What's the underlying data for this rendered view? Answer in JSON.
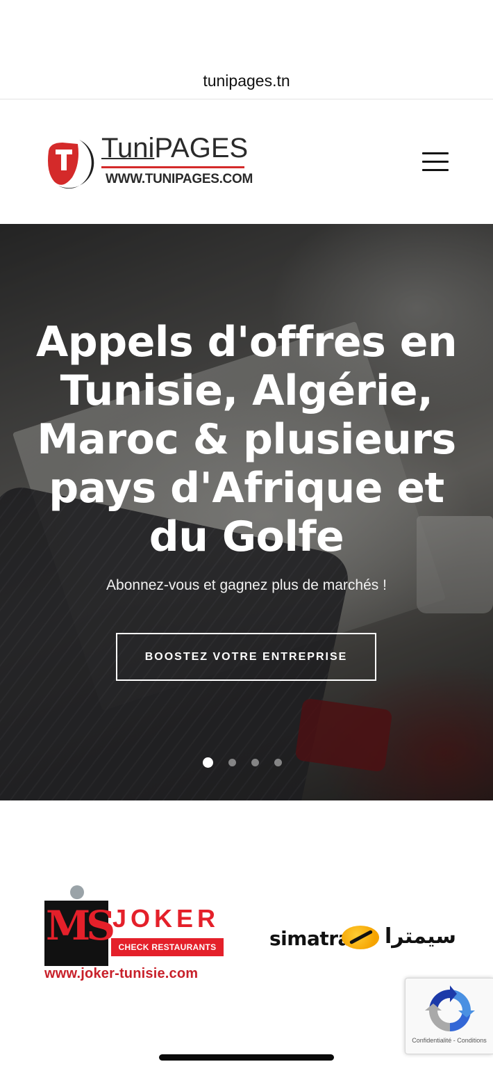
{
  "browser": {
    "url": "tunipages.tn"
  },
  "header": {
    "logo": {
      "brand_tuni": "Tuni",
      "brand_pages": "PAGES",
      "website": "WWW.TUNIPAGES.COM"
    },
    "menu_icon": "hamburger-icon"
  },
  "hero": {
    "title": "Appels d'offres en Tunisie, Algérie, Maroc & plusieurs pays d'Afrique et du Golfe",
    "subtitle": "Abonnez-vous et gagnez plus de marchés !",
    "cta_label": "BOOSTEZ VOTRE ENTREPRISE",
    "slides_total": 4,
    "active_slide": 1
  },
  "partners": {
    "joker": {
      "mark": "MS",
      "name": "JOKER",
      "tagline": "CHECK RESTAURANTS",
      "url": "www.joker-tunisie.com"
    },
    "simatra": {
      "latin": "simatra",
      "arabic": "سيمترا"
    }
  },
  "recaptcha": {
    "links": "Confidentialité - Conditions"
  },
  "colors": {
    "brand_red": "#d42a2a",
    "joker_red": "#e4202a",
    "simatra_yellow": "#f5a300"
  }
}
